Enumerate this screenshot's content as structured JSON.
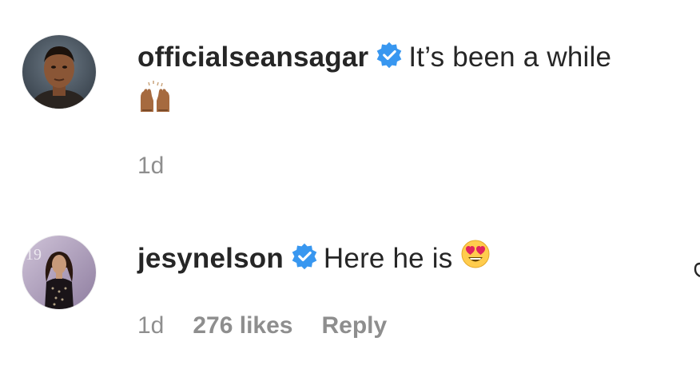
{
  "comments": [
    {
      "username": "officialseansagar",
      "verified": true,
      "text": "It’s been a while",
      "emoji": "raising-hands-emoji",
      "time": "1d"
    },
    {
      "username": "jesynelson",
      "verified": true,
      "text": "Here he is",
      "emoji": "heart-eyes-emoji",
      "time": "1d",
      "likes": "276 likes",
      "reply_label": "Reply"
    }
  ],
  "colors": {
    "text": "#262626",
    "meta": "#8e8e8e",
    "verified_blue": "#3897f0"
  }
}
